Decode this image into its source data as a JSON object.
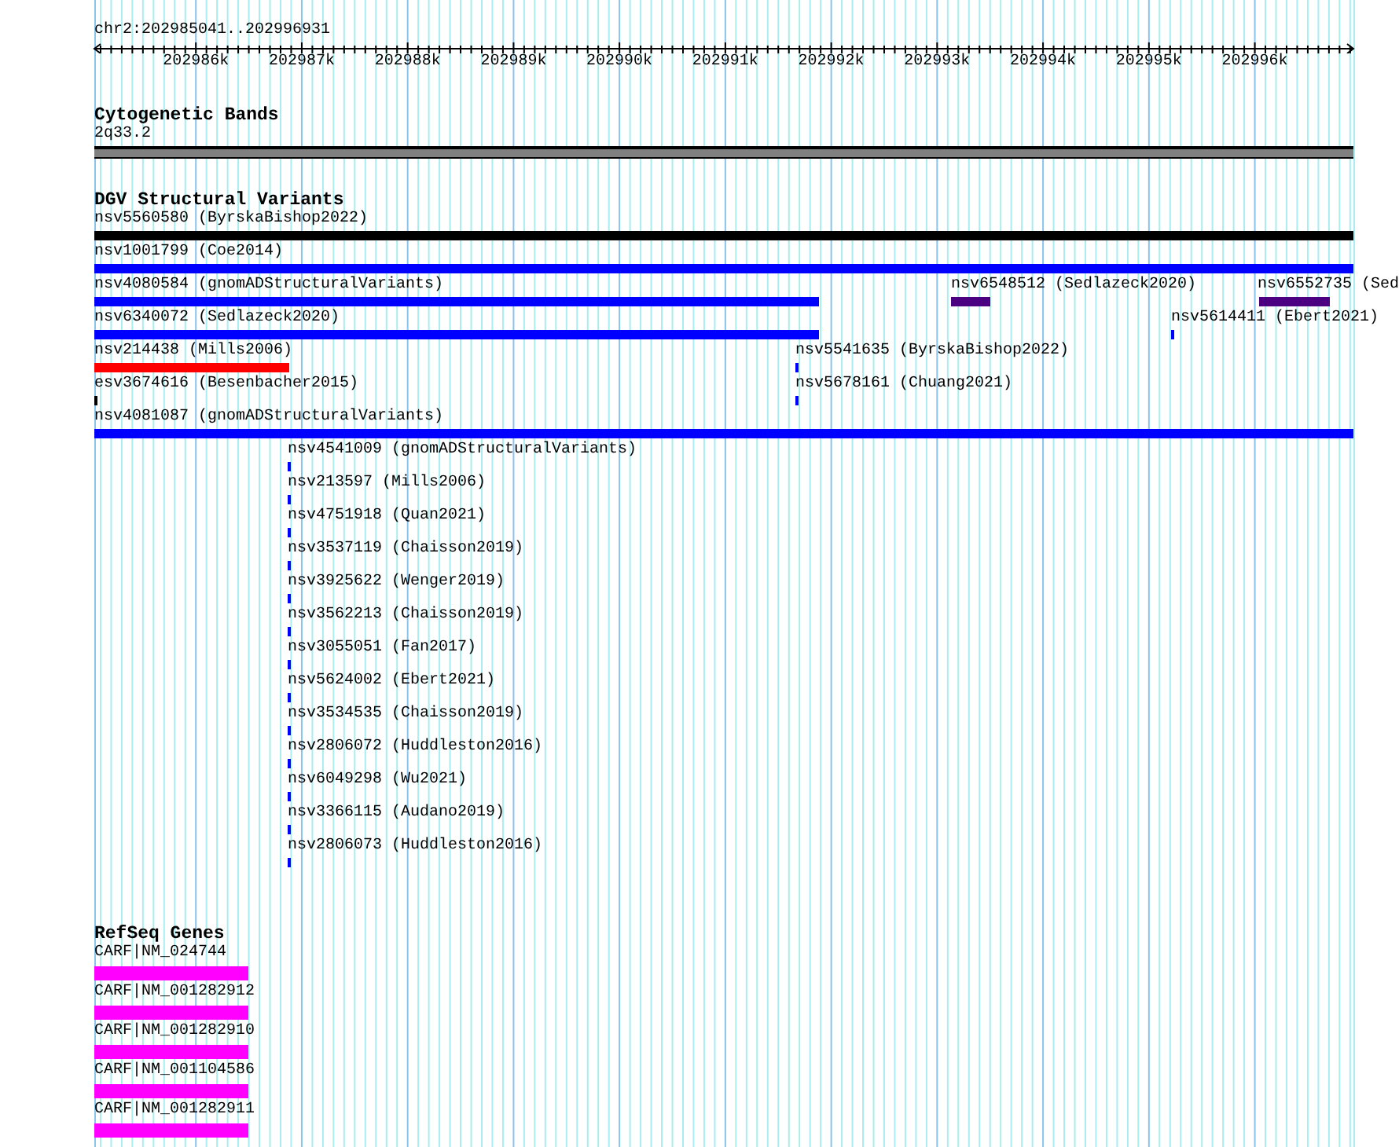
{
  "ruler": {
    "location": "chr2:202985041..202996931",
    "ticks": [
      "202986k",
      "202987k",
      "202988k",
      "202989k",
      "202990k",
      "202991k",
      "202992k",
      "202993k",
      "202994k",
      "202995k",
      "202996k"
    ]
  },
  "tracks": [
    {
      "title": "Cytogenetic Bands",
      "kind": "bands",
      "rows": [
        {
          "features": [
            {
              "label": "2q33.2",
              "color": "#808080"
            }
          ]
        }
      ]
    },
    {
      "title": "DGV Structural Variants",
      "kind": "variants",
      "rows": [
        {
          "features": [
            {
              "label": "nsv5560580 (ByrskaBishop2022)",
              "color": "#000000"
            }
          ]
        },
        {
          "features": [
            {
              "label": "nsv1001799 (Coe2014)",
              "color": "#0000ff"
            }
          ]
        },
        {
          "features": [
            {
              "label": "nsv4080584 (gnomADStructuralVariants)",
              "color": "#0000ff"
            },
            {
              "label": "nsv6548512 (Sedlazeck2020)",
              "color": "#4b0082"
            },
            {
              "label": "nsv6552735 (Sed",
              "color": "#4b0082"
            }
          ]
        },
        {
          "features": [
            {
              "label": "nsv6340072 (Sedlazeck2020)",
              "color": "#0000ff"
            },
            {
              "label": "nsv5614411 (Ebert2021)",
              "color": "#0000ff"
            }
          ]
        },
        {
          "features": [
            {
              "label": "nsv214438 (Mills2006)",
              "color": "#ff0000"
            },
            {
              "label": "nsv5541635 (ByrskaBishop2022)",
              "color": "#0000ff"
            }
          ]
        },
        {
          "features": [
            {
              "label": "esv3674616 (Besenbacher2015)",
              "color": "#000000"
            },
            {
              "label": "nsv5678161 (Chuang2021)",
              "color": "#0000ff"
            }
          ]
        },
        {
          "features": [
            {
              "label": "nsv4081087 (gnomADStructuralVariants)",
              "color": "#0000ff"
            }
          ]
        },
        {
          "features": [
            {
              "label": "nsv4541009 (gnomADStructuralVariants)",
              "color": "#0000ff"
            }
          ]
        },
        {
          "features": [
            {
              "label": "nsv213597 (Mills2006)",
              "color": "#0000ff"
            }
          ]
        },
        {
          "features": [
            {
              "label": "nsv4751918 (Quan2021)",
              "color": "#0000ff"
            }
          ]
        },
        {
          "features": [
            {
              "label": "nsv3537119 (Chaisson2019)",
              "color": "#0000ff"
            }
          ]
        },
        {
          "features": [
            {
              "label": "nsv3925622 (Wenger2019)",
              "color": "#0000ff"
            }
          ]
        },
        {
          "features": [
            {
              "label": "nsv3562213 (Chaisson2019)",
              "color": "#0000ff"
            }
          ]
        },
        {
          "features": [
            {
              "label": "nsv3055051 (Fan2017)",
              "color": "#0000ff"
            }
          ]
        },
        {
          "features": [
            {
              "label": "nsv5624002 (Ebert2021)",
              "color": "#0000ff"
            }
          ]
        },
        {
          "features": [
            {
              "label": "nsv3534535 (Chaisson2019)",
              "color": "#0000ff"
            }
          ]
        },
        {
          "features": [
            {
              "label": "nsv2806072 (Huddleston2016)",
              "color": "#0000ff"
            }
          ]
        },
        {
          "features": [
            {
              "label": "nsv6049298 (Wu2021)",
              "color": "#0000ff"
            }
          ]
        },
        {
          "features": [
            {
              "label": "nsv3366115 (Audano2019)",
              "color": "#0000ff"
            }
          ]
        },
        {
          "features": [
            {
              "label": "nsv2806073 (Huddleston2016)",
              "color": "#0000ff"
            }
          ]
        }
      ]
    },
    {
      "title": "RefSeq Genes",
      "kind": "genes",
      "rows": [
        {
          "features": [
            {
              "label": "CARF|NM_024744",
              "color": "#ff00ff"
            }
          ]
        },
        {
          "features": [
            {
              "label": "CARF|NM_001282912",
              "color": "#ff00ff"
            }
          ]
        },
        {
          "features": [
            {
              "label": "CARF|NM_001282910",
              "color": "#ff00ff"
            }
          ]
        },
        {
          "features": [
            {
              "label": "CARF|NM_001104586",
              "color": "#ff00ff"
            }
          ]
        },
        {
          "features": [
            {
              "label": "CARF|NM_001282911",
              "color": "#ff00ff"
            }
          ]
        }
      ]
    }
  ]
}
